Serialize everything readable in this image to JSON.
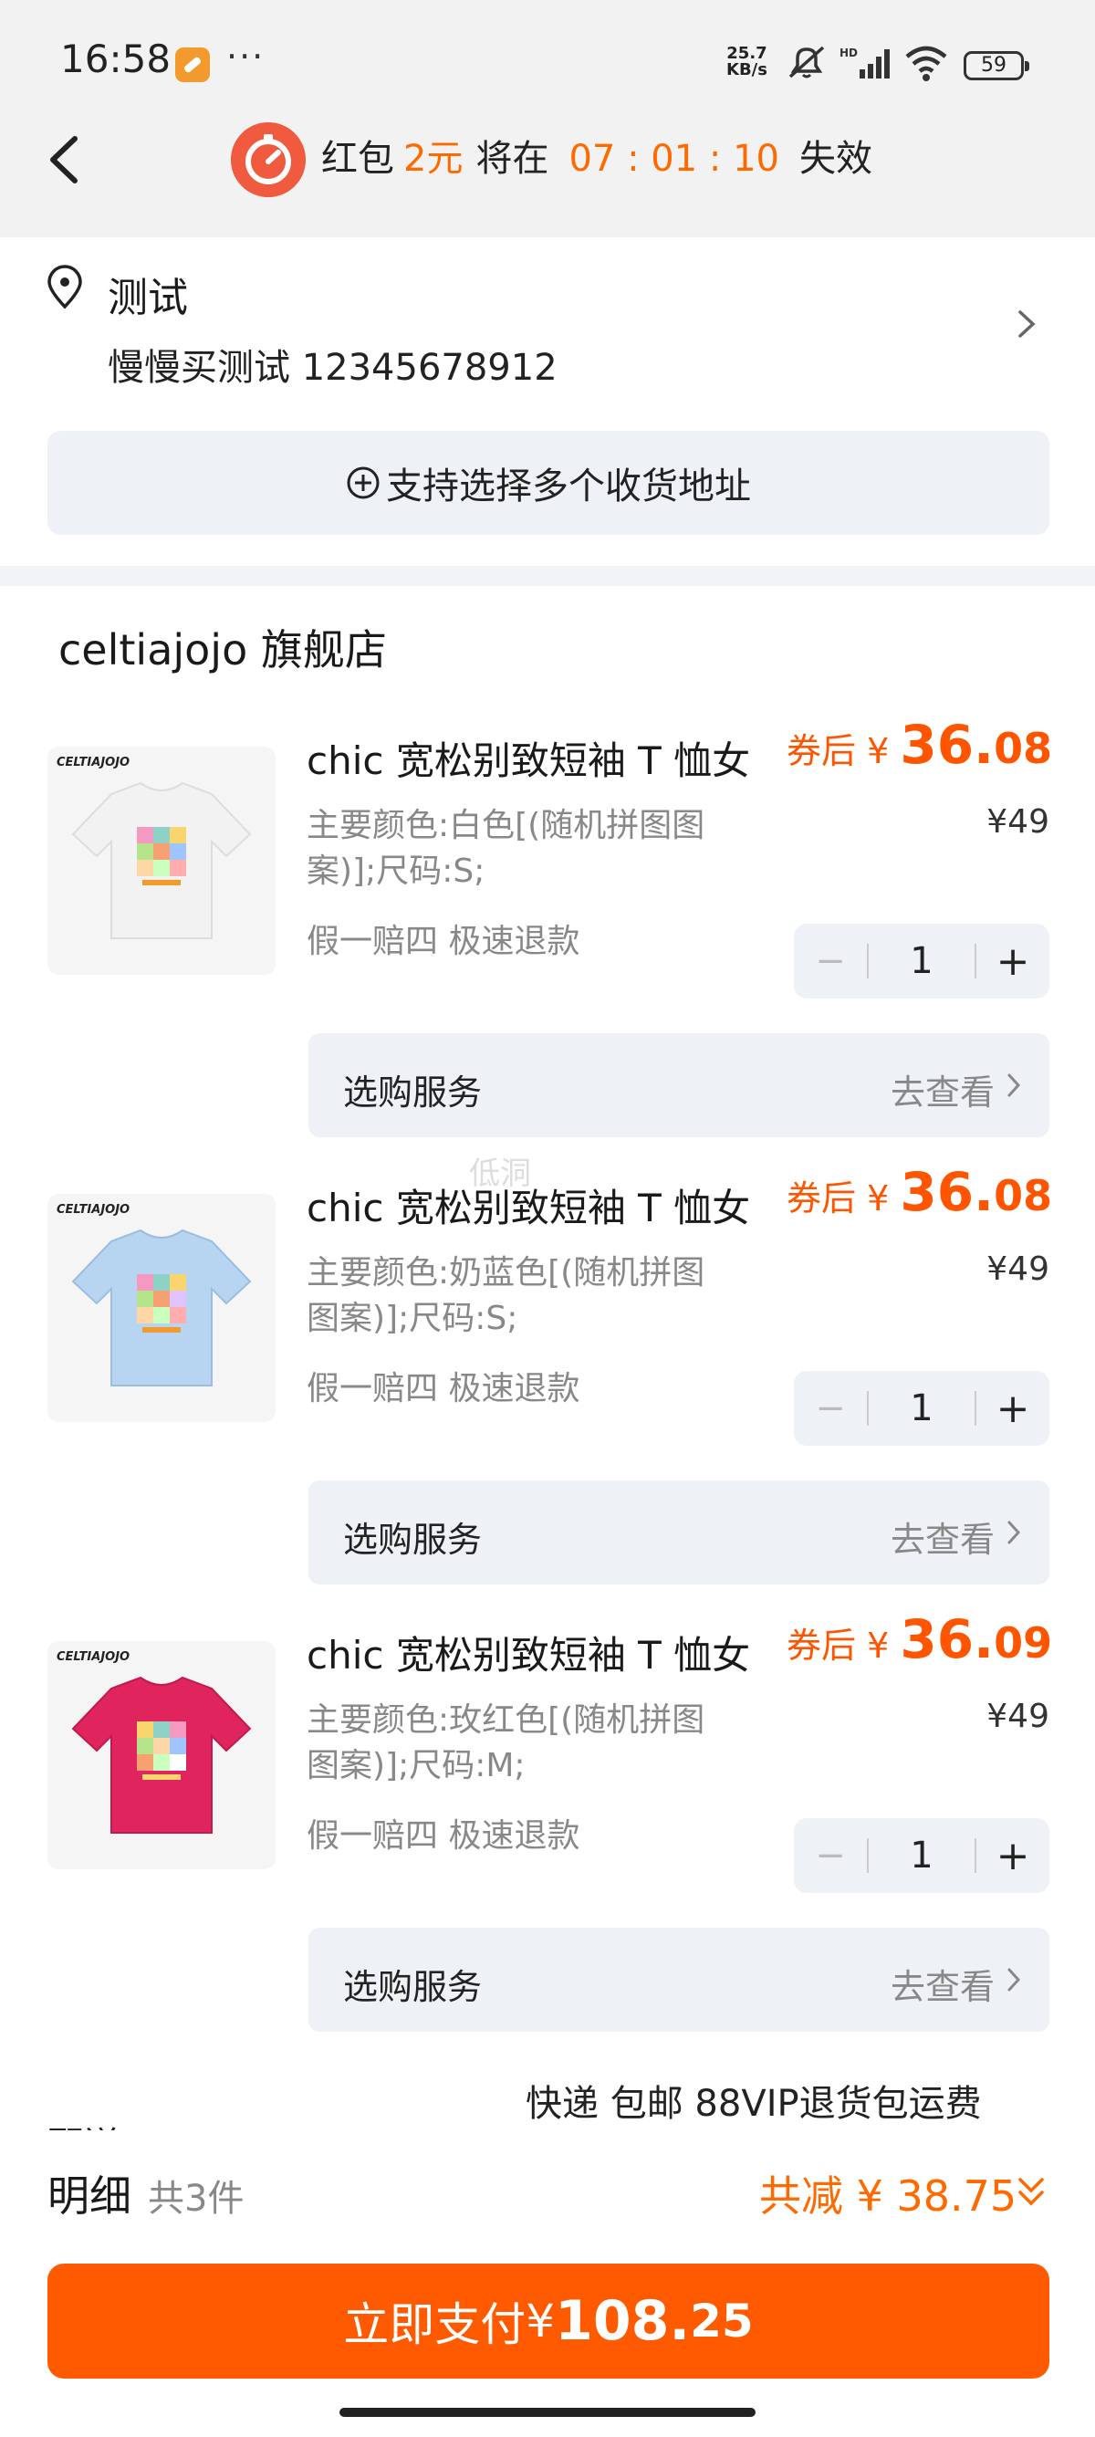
{
  "status_bar": {
    "time": "16:58",
    "dots": "···",
    "net_speed_top": "25.7",
    "net_speed_bottom": "KB/s",
    "battery": "59"
  },
  "header": {
    "rp_prefix": "红包",
    "rp_amount": "2元",
    "rp_mid": "将在",
    "rp_time": "07 : 01 : 10",
    "rp_suffix": "失效"
  },
  "address": {
    "name": "测试",
    "contact": "慢慢买测试 12345678912",
    "multi_address_label": "支持选择多个收货地址"
  },
  "shop": {
    "name": "celtiajojo 旗舰店"
  },
  "products": [
    {
      "brand": "CELTIAJOJO",
      "shirt_color": "#f2f2f2",
      "title": "chic 宽松别致短袖 T 恤女",
      "spec_line1": "主要颜色:白色[(随机拼图图",
      "spec_line2": "案)];尺码:S;",
      "tags": "假一赔四  极速退款",
      "price_label": "券后 ¥ ",
      "price_int": "36.",
      "price_dec": "08",
      "original_price": "¥49",
      "qty_minus": "−",
      "quantity": "1",
      "qty_plus": "+",
      "service_label": "选购服务",
      "service_link": "去查看"
    },
    {
      "brand": "CELTIAJOJO",
      "shirt_color": "#b7d4f1",
      "title": "chic 宽松别致短袖 T 恤女",
      "spec_line1": "主要颜色:奶蓝色[(随机拼图",
      "spec_line2": "图案)];尺码:S;",
      "tags": "假一赔四  极速退款",
      "price_label": "券后 ¥ ",
      "price_int": "36.",
      "price_dec": "08",
      "original_price": "¥49",
      "qty_minus": "−",
      "quantity": "1",
      "qty_plus": "+",
      "service_label": "选购服务",
      "service_link": "去查看"
    },
    {
      "brand": "CELTIAJOJO",
      "shirt_color": "#e0245e",
      "title": "chic 宽松别致短袖 T 恤女",
      "spec_line1": "主要颜色:玫红色[(随机拼图",
      "spec_line2": "图案)];尺码:M;",
      "tags": "假一赔四  极速退款",
      "price_label": "券后 ¥ ",
      "price_int": "36.",
      "price_dec": "09",
      "original_price": "¥49",
      "qty_minus": "−",
      "quantity": "1",
      "qty_plus": "+",
      "service_label": "选购服务",
      "service_link": "去查看"
    }
  ],
  "watermark": "低洞",
  "shipping_text": "快递 包邮 88VIP退货包运费",
  "cut_text": "配送",
  "bottom": {
    "detail_label": "明细",
    "count": "共3件",
    "saving": "共减 ¥ 38.75",
    "pay_label": "立即支付",
    "pay_currency": "¥",
    "pay_int": "108.",
    "pay_dec": "25"
  },
  "colors": {
    "accent": "#ff5a00",
    "price": "#ff5500",
    "card_bg": "#eef2f6"
  }
}
